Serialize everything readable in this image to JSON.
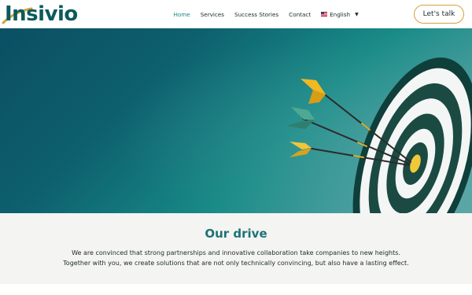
{
  "brand": {
    "name": "Insivio"
  },
  "nav": {
    "items": [
      {
        "label": "Home",
        "active": true
      },
      {
        "label": "Services",
        "active": false
      },
      {
        "label": "Success Stories",
        "active": false
      },
      {
        "label": "Contact",
        "active": false
      }
    ],
    "language": {
      "label": "English",
      "flag_icon": "us-flag-icon"
    }
  },
  "cta": {
    "label": "Let's talk"
  },
  "hero": {
    "image": "target-with-arrows",
    "colors": {
      "gradient_start": "#0b4f63",
      "gradient_end": "#5aa6a6"
    }
  },
  "drive": {
    "title": "Our drive",
    "line1": "We are convinced that strong partnerships and innovative collaboration take companies to new heights.",
    "line2": "Together with you, we create solutions that are not only technically convincing, but also have a lasting effect."
  },
  "colors": {
    "accent": "#1a8585",
    "brand": "#0b5a5c",
    "cta_border": "#d4a23a",
    "section_bg": "#f4f4f2"
  }
}
